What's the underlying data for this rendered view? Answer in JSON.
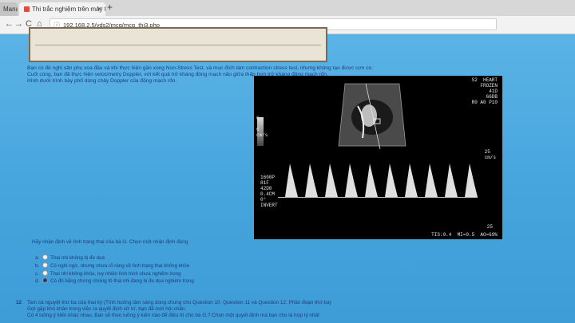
{
  "browser": {
    "tabs": [
      {
        "label": "Mana"
      },
      {
        "label": "Thi trắc nghiệm trên máy t"
      }
    ],
    "new_tab": "+",
    "nav": {
      "back": "←",
      "forward": "→",
      "reload": "C",
      "home": "⌂"
    },
    "url": "192.168.2.5/yds2/mcq/mcq_thi3.php"
  },
  "content": {
    "description_lines": [
      "Bạn có đề nghị sản phụ xoa đầu và khi thực hiện gần xong Non-Stress Test, và mục đích làm contraction stress test, nhưng không tạo được cơn co.",
      "Cuối cùng, bạn đã thực hiện velocimetry Doppler, với kết quả trở kháng động mạch não giữa thấp hơn trở kháng động mạch rốn.",
      "Hình dưới trình bày phổ dòng chảy Doppler của động mạch rốn."
    ],
    "ultrasound": {
      "top_right": "S2  HEART\nFROZEN\n41D\n66DB\nR0 A0 P10",
      "left_scale": "6\n\n6\ncm/s",
      "right_scale_top": "25\ncm/s",
      "right_scale_bottom": "25",
      "params": "1600P\n81F\n42D0\n0.4CM\n0°\nINVERT",
      "footer": "TIS:0.4  MI=0.5  AO=69%"
    },
    "question": "Hãy nhận định về tình trạng thai của bà G. Chọn một nhận định đúng",
    "options": [
      {
        "letter": "a.",
        "text": "Thai nhi không bị đe dọa",
        "selected": false
      },
      {
        "letter": "b.",
        "text": "Có nghi ngờ, nhưng chưa rõ ràng về tình trạng thai không khỏe",
        "selected": false
      },
      {
        "letter": "c.",
        "text": "Thai nhi không khỏe, tuy nhiên tình hình chưa nghiêm trọng",
        "selected": false
      },
      {
        "letter": "d.",
        "text": "Có đủ bằng chứng chứng tỏ thai nhi đang bị đe dọa nghiêm trọng",
        "selected": true
      }
    ],
    "next_question": {
      "number": "12",
      "lines": [
        "Tam cá nguyệt thứ ba của thai kỳ (Tình huống lâm sàng dùng chung cho Question 10, Question 11 và Question 12. Phần đoạn thứ ba)",
        "Gợi gặp khó khăn trong việc ra quyết định xử trí, bạn đã mời hội chẩn.",
        "Có 4 luồng ý kiến khác nhau. Bạn sẽ theo luồng ý kiến nào để điều trị cho bà G.? Chọn một quyết định mà bạn cho là hợp lý nhất"
      ]
    }
  },
  "colors": {
    "page_bg": "#4aa8df",
    "text": "#1d3f7a",
    "ultrasound_bg": "#000000"
  }
}
